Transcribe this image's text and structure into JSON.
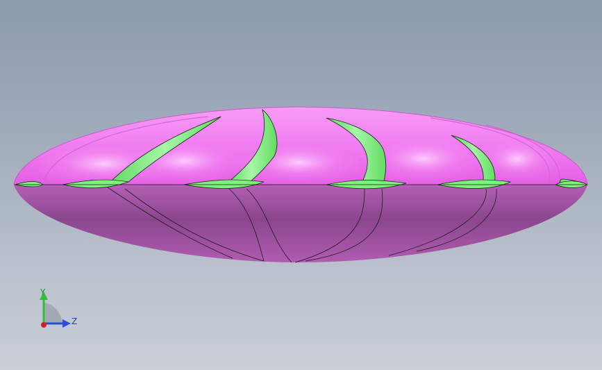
{
  "viewport": {
    "background_top": "#8c9aae",
    "background_bottom": "#c9ced7"
  },
  "model": {
    "part": "disc-rotor",
    "body_color": "#f17df1",
    "body_shadow_color": "#9a4a9d",
    "blade_color": "#7ef07e",
    "edge_color": "#1a1a1a"
  },
  "triad": {
    "y_label": "Y",
    "z_label": "Z",
    "y_color": "#2fbf3a",
    "z_color": "#2a4fd6",
    "x_color": "#d02020"
  }
}
